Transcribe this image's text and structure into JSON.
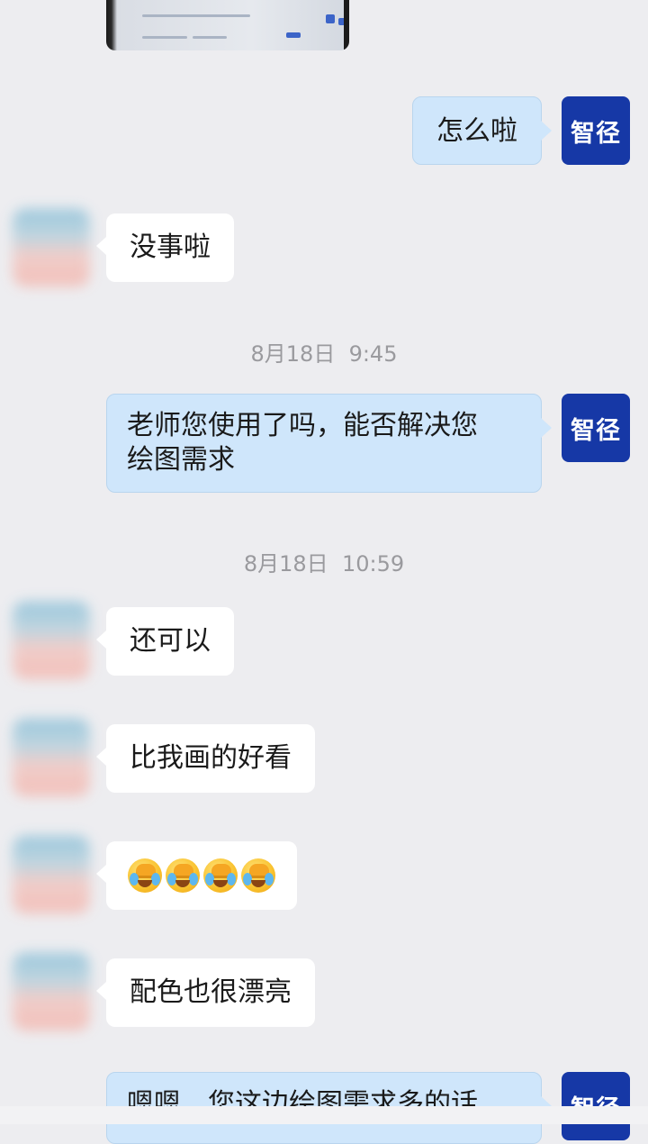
{
  "brand_avatar": {
    "label": "智径",
    "color": "#1638a6"
  },
  "colors": {
    "background": "#ededf0",
    "incoming_bubble": "#ffffff",
    "outgoing_bubble": "#cfe6fb",
    "timestamp": "#9a9a9e"
  },
  "messages": {
    "m1": {
      "text": "怎么啦"
    },
    "m2": {
      "text": "没事啦"
    },
    "ts1": {
      "text": "8月18日  9:45"
    },
    "m3": {
      "line1": "老师您使用了吗，能否解决您",
      "line2": "绘图需求"
    },
    "ts2": {
      "text": "8月18日  10:59"
    },
    "m4": {
      "text": "还可以"
    },
    "m5": {
      "text": "比我画的好看"
    },
    "m6": {
      "emoji": [
        "crying-laughing-icon",
        "crying-laughing-icon",
        "crying-laughing-icon",
        "crying-laughing-icon"
      ]
    },
    "m7": {
      "text": "配色也很漂亮"
    },
    "m8": {
      "text": "嗯嗯，您这边绘图需求多的话"
    }
  }
}
